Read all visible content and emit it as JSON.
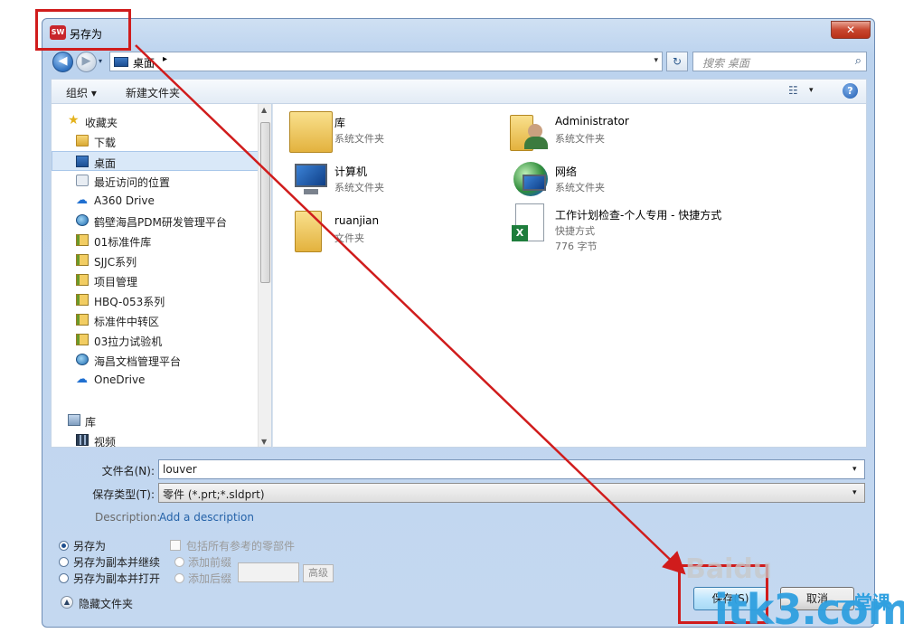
{
  "window": {
    "title": "另存为",
    "app_icon_text": "SW",
    "close_glyph": "✕"
  },
  "address_bar": {
    "path": "桌面",
    "separator": "▸",
    "dropdown_glyph": "▾",
    "refresh_glyph": "↻",
    "back_glyph": "◀",
    "forward_glyph": "▶"
  },
  "search": {
    "placeholder": "搜索 桌面",
    "icon": "search-icon"
  },
  "toolbar": {
    "organize": "组织 ▾",
    "new_folder": "新建文件夹",
    "view_glyph": "☷",
    "view_drop": "▾",
    "help": "?"
  },
  "nav": {
    "favorites_header": "收藏夹",
    "items": [
      {
        "label": "下载",
        "icon": "download-folder-icon"
      },
      {
        "label": "桌面",
        "icon": "desktop-icon",
        "selected": true
      },
      {
        "label": "最近访问的位置",
        "icon": "recent-places-icon"
      },
      {
        "label": "A360 Drive",
        "icon": "a360-drive-icon"
      },
      {
        "label": "鹤壁海昌PDM研发管理平台",
        "icon": "pdm-platform-icon"
      },
      {
        "label": "01标准件库",
        "icon": "folder-icon"
      },
      {
        "label": "SJJC系列",
        "icon": "folder-icon"
      },
      {
        "label": "项目管理",
        "icon": "folder-icon"
      },
      {
        "label": "HBQ-053系列",
        "icon": "folder-icon"
      },
      {
        "label": "标准件中转区",
        "icon": "folder-icon"
      },
      {
        "label": "03拉力试验机",
        "icon": "folder-icon"
      },
      {
        "label": "海昌文档管理平台",
        "icon": "doc-platform-icon"
      },
      {
        "label": "OneDrive",
        "icon": "onedrive-icon"
      }
    ],
    "libraries_header": "库",
    "library_items": [
      {
        "label": "视频",
        "icon": "video-library-icon"
      }
    ]
  },
  "content": {
    "items": [
      {
        "name": "库",
        "sub": "系统文件夹",
        "icon": "libraries-folder-icon"
      },
      {
        "name": "Administrator",
        "sub": "系统文件夹",
        "icon": "user-folder-icon"
      },
      {
        "name": "计算机",
        "sub": "系统文件夹",
        "icon": "computer-icon"
      },
      {
        "name": "网络",
        "sub": "系统文件夹",
        "icon": "network-icon"
      },
      {
        "name": "ruanjian",
        "sub": "文件夹",
        "icon": "folder-icon"
      },
      {
        "name": "工作计划检查-个人专用 - 快捷方式",
        "sub": "快捷方式",
        "sub2": "776 字节",
        "icon": "excel-shortcut-icon"
      }
    ]
  },
  "form": {
    "filename_label": "文件名(N):",
    "filename_value": "louver",
    "filetype_label": "保存类型(T):",
    "filetype_value": "零件 (*.prt;*.sldprt)",
    "description_label": "Description:",
    "description_link": "Add a description",
    "drop_glyph": "▾"
  },
  "options": {
    "save_as": "另存为",
    "save_copy_continue": "另存为副本并继续",
    "save_copy_open": "另存为副本并打开",
    "include_refs": "包括所有参考的零部件",
    "add_prefix": "添加前缀",
    "add_suffix": "添加后缀",
    "advanced": "高级",
    "hide_folders": "隐藏文件夹",
    "hide_glyph": "▲"
  },
  "buttons": {
    "save": "保存(S)",
    "cancel": "取消"
  },
  "watermark": {
    "baidu": "Baidu",
    "site": "itk3.com",
    "course": "一堂课"
  },
  "colors": {
    "annotation": "#d01c1c",
    "selection": "#d9e8f8",
    "link": "#2462a8"
  }
}
